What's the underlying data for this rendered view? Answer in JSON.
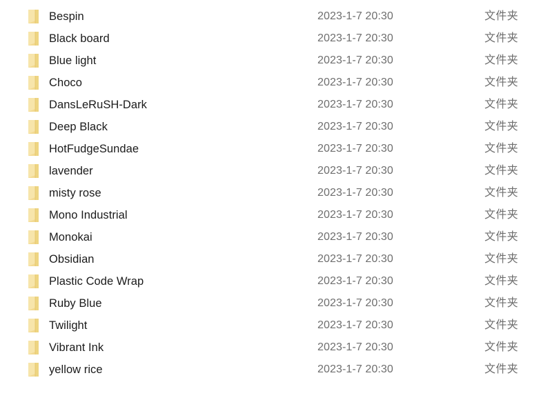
{
  "window": {
    "view_mode": "details",
    "background_color": "#ffffff"
  },
  "colors": {
    "folder_icon_light": "#f7e3a1",
    "folder_icon_mid": "#f0d584",
    "folder_icon_dark": "#e7c765",
    "name_text": "#1b1b1b",
    "meta_text": "#6e6e6e"
  },
  "columns": {
    "name_key": "name",
    "date_key": "date_modified",
    "type_key": "type"
  },
  "icons": {
    "folder": "folder-icon"
  },
  "rows": [
    {
      "name": "Bespin",
      "date_modified": "2023-1-7 20:30",
      "type": "文件夹"
    },
    {
      "name": "Black board",
      "date_modified": "2023-1-7 20:30",
      "type": "文件夹"
    },
    {
      "name": "Blue light",
      "date_modified": "2023-1-7 20:30",
      "type": "文件夹"
    },
    {
      "name": "Choco",
      "date_modified": "2023-1-7 20:30",
      "type": "文件夹"
    },
    {
      "name": "DansLeRuSH-Dark",
      "date_modified": "2023-1-7 20:30",
      "type": "文件夹"
    },
    {
      "name": "Deep Black",
      "date_modified": "2023-1-7 20:30",
      "type": "文件夹"
    },
    {
      "name": "HotFudgeSundae",
      "date_modified": "2023-1-7 20:30",
      "type": "文件夹"
    },
    {
      "name": "lavender",
      "date_modified": "2023-1-7 20:30",
      "type": "文件夹"
    },
    {
      "name": "misty rose",
      "date_modified": "2023-1-7 20:30",
      "type": "文件夹"
    },
    {
      "name": "Mono Industrial",
      "date_modified": "2023-1-7 20:30",
      "type": "文件夹"
    },
    {
      "name": "Monokai",
      "date_modified": "2023-1-7 20:30",
      "type": "文件夹"
    },
    {
      "name": "Obsidian",
      "date_modified": "2023-1-7 20:30",
      "type": "文件夹"
    },
    {
      "name": "Plastic Code Wrap",
      "date_modified": "2023-1-7 20:30",
      "type": "文件夹"
    },
    {
      "name": "Ruby Blue",
      "date_modified": "2023-1-7 20:30",
      "type": "文件夹"
    },
    {
      "name": "Twilight",
      "date_modified": "2023-1-7 20:30",
      "type": "文件夹"
    },
    {
      "name": "Vibrant Ink",
      "date_modified": "2023-1-7 20:30",
      "type": "文件夹"
    },
    {
      "name": "yellow rice",
      "date_modified": "2023-1-7 20:30",
      "type": "文件夹"
    }
  ]
}
